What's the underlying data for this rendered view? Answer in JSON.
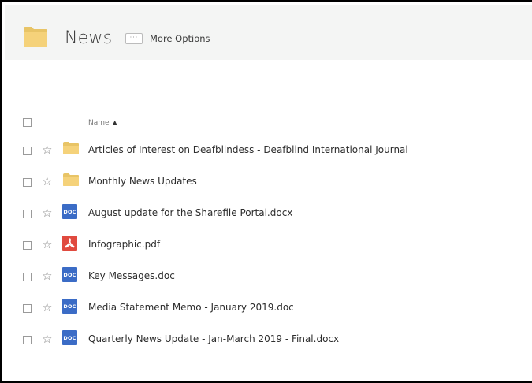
{
  "header": {
    "title": "News",
    "more_options_dots": "···",
    "more_options_label": "More Options"
  },
  "list": {
    "column_name": "Name",
    "sort_indicator": "▲",
    "items": [
      {
        "name": "Articles of Interest on Deafblindess - Deafblind International Journal",
        "type": "folder"
      },
      {
        "name": "Monthly News Updates",
        "type": "folder"
      },
      {
        "name": "August update for the Sharefile Portal.docx",
        "type": "doc"
      },
      {
        "name": "Infographic.pdf",
        "type": "pdf"
      },
      {
        "name": "Key Messages.doc",
        "type": "doc"
      },
      {
        "name": "Media Statement Memo - January 2019.doc",
        "type": "doc"
      },
      {
        "name": "Quarterly News Update - Jan-March 2019 - Final.docx",
        "type": "doc"
      }
    ],
    "doc_badge_text": "DOC",
    "star_glyph": "☆"
  },
  "colors": {
    "folder": "#f5d27a",
    "doc": "#3b6cc6",
    "pdf": "#e04a3f",
    "header_bg": "#f4f5f4"
  }
}
